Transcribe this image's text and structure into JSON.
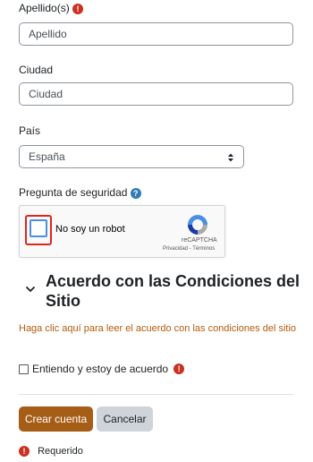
{
  "form": {
    "apellido": {
      "label": "Apellido(s)",
      "value": "Apellido",
      "required": true
    },
    "ciudad": {
      "label": "Ciudad",
      "value": "Ciudad"
    },
    "pais": {
      "label": "País",
      "selected": "España"
    },
    "security": {
      "label": "Pregunta de seguridad"
    },
    "recaptcha": {
      "checkbox_label": "No soy un robot",
      "brand": "reCAPTCHA",
      "privacy": "Privacidad",
      "separator": " - ",
      "terms": "Términos"
    }
  },
  "agreement": {
    "heading": "Acuerdo con las Condiciones del Sitio",
    "link": "Haga clic aquí para leer el acuerdo con las condiciones del sitio",
    "checkbox_label": "Entiendo y estoy de acuerdo"
  },
  "buttons": {
    "submit": "Crear cuenta",
    "cancel": "Cancelar"
  },
  "legend": {
    "required": "Requerido"
  },
  "icons": {
    "required": "exclamation-icon",
    "help": "question-icon",
    "collapse": "chevron-down-icon",
    "select": "select-updown-icon"
  },
  "colors": {
    "required": "#ca3120",
    "help": "#2f7bb3",
    "link": "#b35a0c",
    "primary_button": "#a65d16",
    "secondary_button": "#ced4da",
    "recaptcha_highlight": "#e0261b"
  }
}
